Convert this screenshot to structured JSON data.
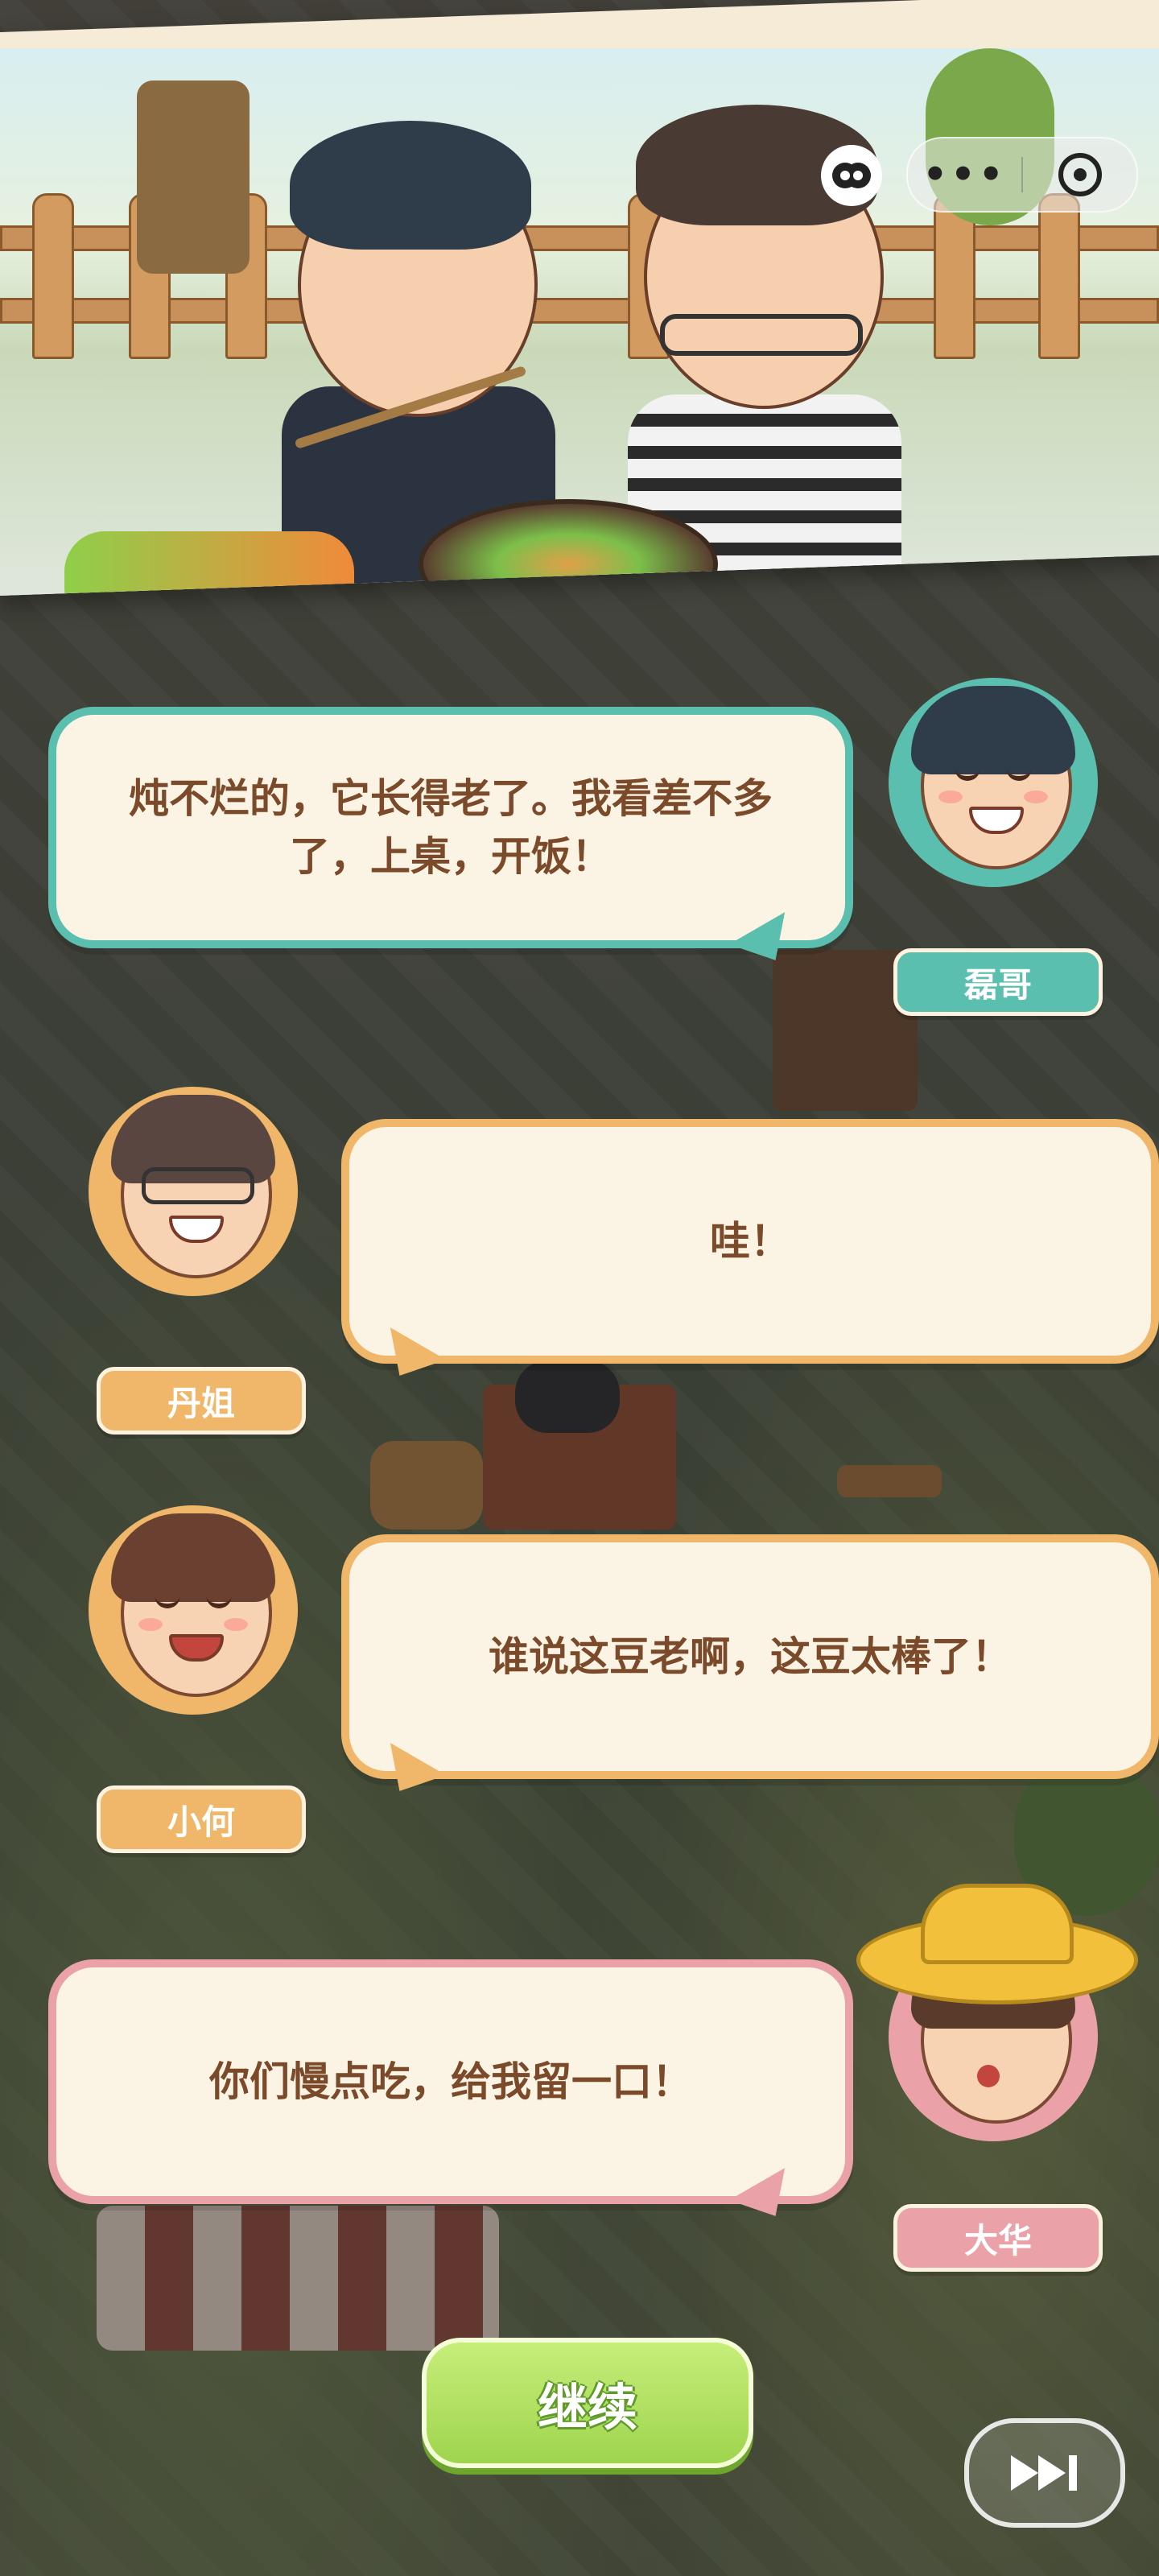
{
  "banner": {
    "icons": [
      "wechat-game-icon",
      "more-icon",
      "close-icon"
    ]
  },
  "dialogue": [
    {
      "speaker": "磊哥",
      "text": "炖不烂的，它长得老了。我看差不多了，上桌，开饭！",
      "accent": "#5bbfaf"
    },
    {
      "speaker": "丹姐",
      "text": "哇！",
      "accent": "#f0b66a"
    },
    {
      "speaker": "小何",
      "text": "谁说这豆老啊，这豆太棒了！",
      "accent": "#f0b66a"
    },
    {
      "speaker": "大华",
      "text": "你们慢点吃，给我留一口！",
      "accent": "#eaa2a8"
    }
  ],
  "controls": {
    "continue_label": "继续",
    "skip_icon": "fast-forward-icon"
  },
  "colors": {
    "teal": "#5bbfaf",
    "orange": "#f0b66a",
    "pink": "#eaa2a8",
    "text_brown": "#7a4a2a",
    "button_green": "#9fd44e"
  }
}
